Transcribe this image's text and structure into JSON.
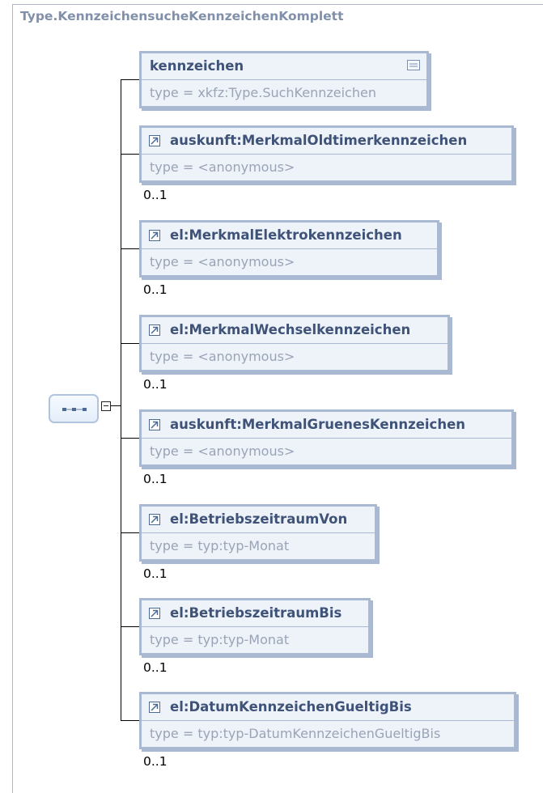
{
  "complex_type": {
    "title": "Type.KennzeichensucheKennzeichenKomplett"
  },
  "sequence": {
    "icon": "sequence-icon",
    "toggle_icon": "collapse-icon"
  },
  "elements": [
    {
      "name": "kennzeichen",
      "type": "type = xkfz:Type.SuchKennzeichen",
      "occurrence": "",
      "icon": "documentation-icon"
    },
    {
      "name": "auskunft:MerkmalOldtimerkennzeichen",
      "type": "type = <anonymous>",
      "occurrence": "0..1",
      "icon": "reference-arrow-icon"
    },
    {
      "name": "el:MerkmalElektrokennzeichen",
      "type": "type = <anonymous>",
      "occurrence": "0..1",
      "icon": "reference-arrow-icon"
    },
    {
      "name": "el:MerkmalWechselkennzeichen",
      "type": "type = <anonymous>",
      "occurrence": "0..1",
      "icon": "reference-arrow-icon"
    },
    {
      "name": "auskunft:MerkmalGruenesKennzeichen",
      "type": "type = <anonymous>",
      "occurrence": "0..1",
      "icon": "reference-arrow-icon"
    },
    {
      "name": "el:BetriebszeitraumVon",
      "type": "type = typ:typ-Monat",
      "occurrence": "0..1",
      "icon": "reference-arrow-icon"
    },
    {
      "name": "el:BetriebszeitraumBis",
      "type": "type = typ:typ-Monat",
      "occurrence": "0..1",
      "icon": "reference-arrow-icon"
    },
    {
      "name": "el:DatumKennzeichenGueltigBis",
      "type": "type = typ:typ-DatumKennzeichenGueltigBis",
      "occurrence": "0..1",
      "icon": "reference-arrow-icon"
    }
  ],
  "colors": {
    "border": "#a9b9d2",
    "fill": "#eef3fa",
    "name": "#3f5278",
    "type": "#9aa4b6"
  }
}
